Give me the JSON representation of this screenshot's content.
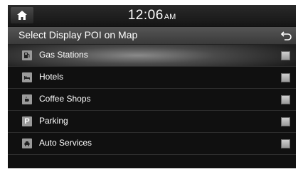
{
  "status": {
    "time": "12:06",
    "ampm": "AM"
  },
  "header": {
    "title": "Select Display POI on Map"
  },
  "items": [
    {
      "label": "Gas Stations",
      "icon": "gas-station-icon",
      "selected": true
    },
    {
      "label": "Hotels",
      "icon": "hotel-icon",
      "selected": false
    },
    {
      "label": "Coffee Shops",
      "icon": "coffee-cup-icon",
      "selected": false
    },
    {
      "label": "Parking",
      "icon": "parking-icon",
      "icon_text": "P",
      "selected": false
    },
    {
      "label": "Auto Services",
      "icon": "car-service-icon",
      "selected": false
    }
  ]
}
